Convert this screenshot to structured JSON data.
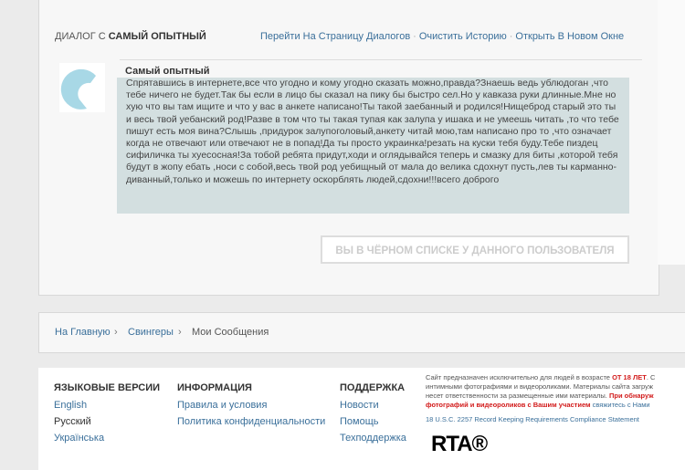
{
  "dialog": {
    "prefix": "ДИАЛОГ С",
    "name": "САМЫЙ ОПЫТНЫЙ",
    "links": [
      "Перейти На Страницу Диалогов",
      "Очистить Историю",
      "Открыть В Новом Окне"
    ]
  },
  "message": {
    "author": "Самый опытный",
    "text": "Спрятавшись в интернете,все что угодно и кому угодно сказать можно,правда?Знаешь ведь ублюдоган ,что тебе ничего не будет.Так бы если в лицо бы сказал на пику бы быстро сел.Но у кавказа руки длинные.Мне но хую что вы там ищите и что у вас в анкете написано!Ты такой заебанный и родился!Нищеброд старый это ты и весь твой уебанский род!Разве в том что ты такая тупая как залупа у ишака и не умеешь читать ,то что тебе пишут есть моя вина?Слышь ,придурок залупоголовый,анкету читай мою,там написано про то ,что означает когда не отвечают или отвечают не в попад!Да ты просто украинка!резать на куски тебя буду.Тебе пиздец сифиличка ты хуесосная!За тобой ребята придут,ходи и оглядывайся теперь и смазку для биты ,которой тебя будут в жопу ебать ,носи с собой,весь твой род уебищный от мала до велика сдохнут пусть,лев ты карманно-диванный,только и можешь по интернету оскорблять людей,сдохни!!!всего доброго"
  },
  "blacklist_button": "ВЫ В ЧЁРНОМ СПИСКЕ У ДАННОГО ПОЛЬЗОВАТЕЛЯ",
  "breadcrumb": [
    "На Главную",
    "Свингеры",
    "Мои Сообщения"
  ],
  "footer": {
    "languages": {
      "title": "ЯЗЫКОВЫЕ ВЕРСИИ",
      "items": [
        "English",
        "Русский",
        "Українська"
      ]
    },
    "info": {
      "title": "ИНФОРМАЦИЯ",
      "items": [
        "Правила и условия",
        "Политика конфиденциальности"
      ]
    },
    "support": {
      "title": "ПОДДЕРЖКА",
      "items": [
        "Новости",
        "Помощь",
        "Техподдержка"
      ]
    },
    "legal": {
      "l1a": "Сайт предназначен исключительно для людей в возрасте ",
      "l1b": "ОТ 18 ЛЕТ",
      "l1c": ". С",
      "l2": "интимными фотографиями и видеороликами. Материалы сайта загруж",
      "l3a": "несет ответственности за размещенные ими материалы. ",
      "l3b": "При обнаруж",
      "l4a": "фотографий и видеороликов с Вашим участием",
      "l4b": " свяжитесь с Нами",
      "compliance": "18 U.S.C. 2257 Record Keeping Requirements Compliance Statement"
    },
    "logo": "RTA®"
  }
}
